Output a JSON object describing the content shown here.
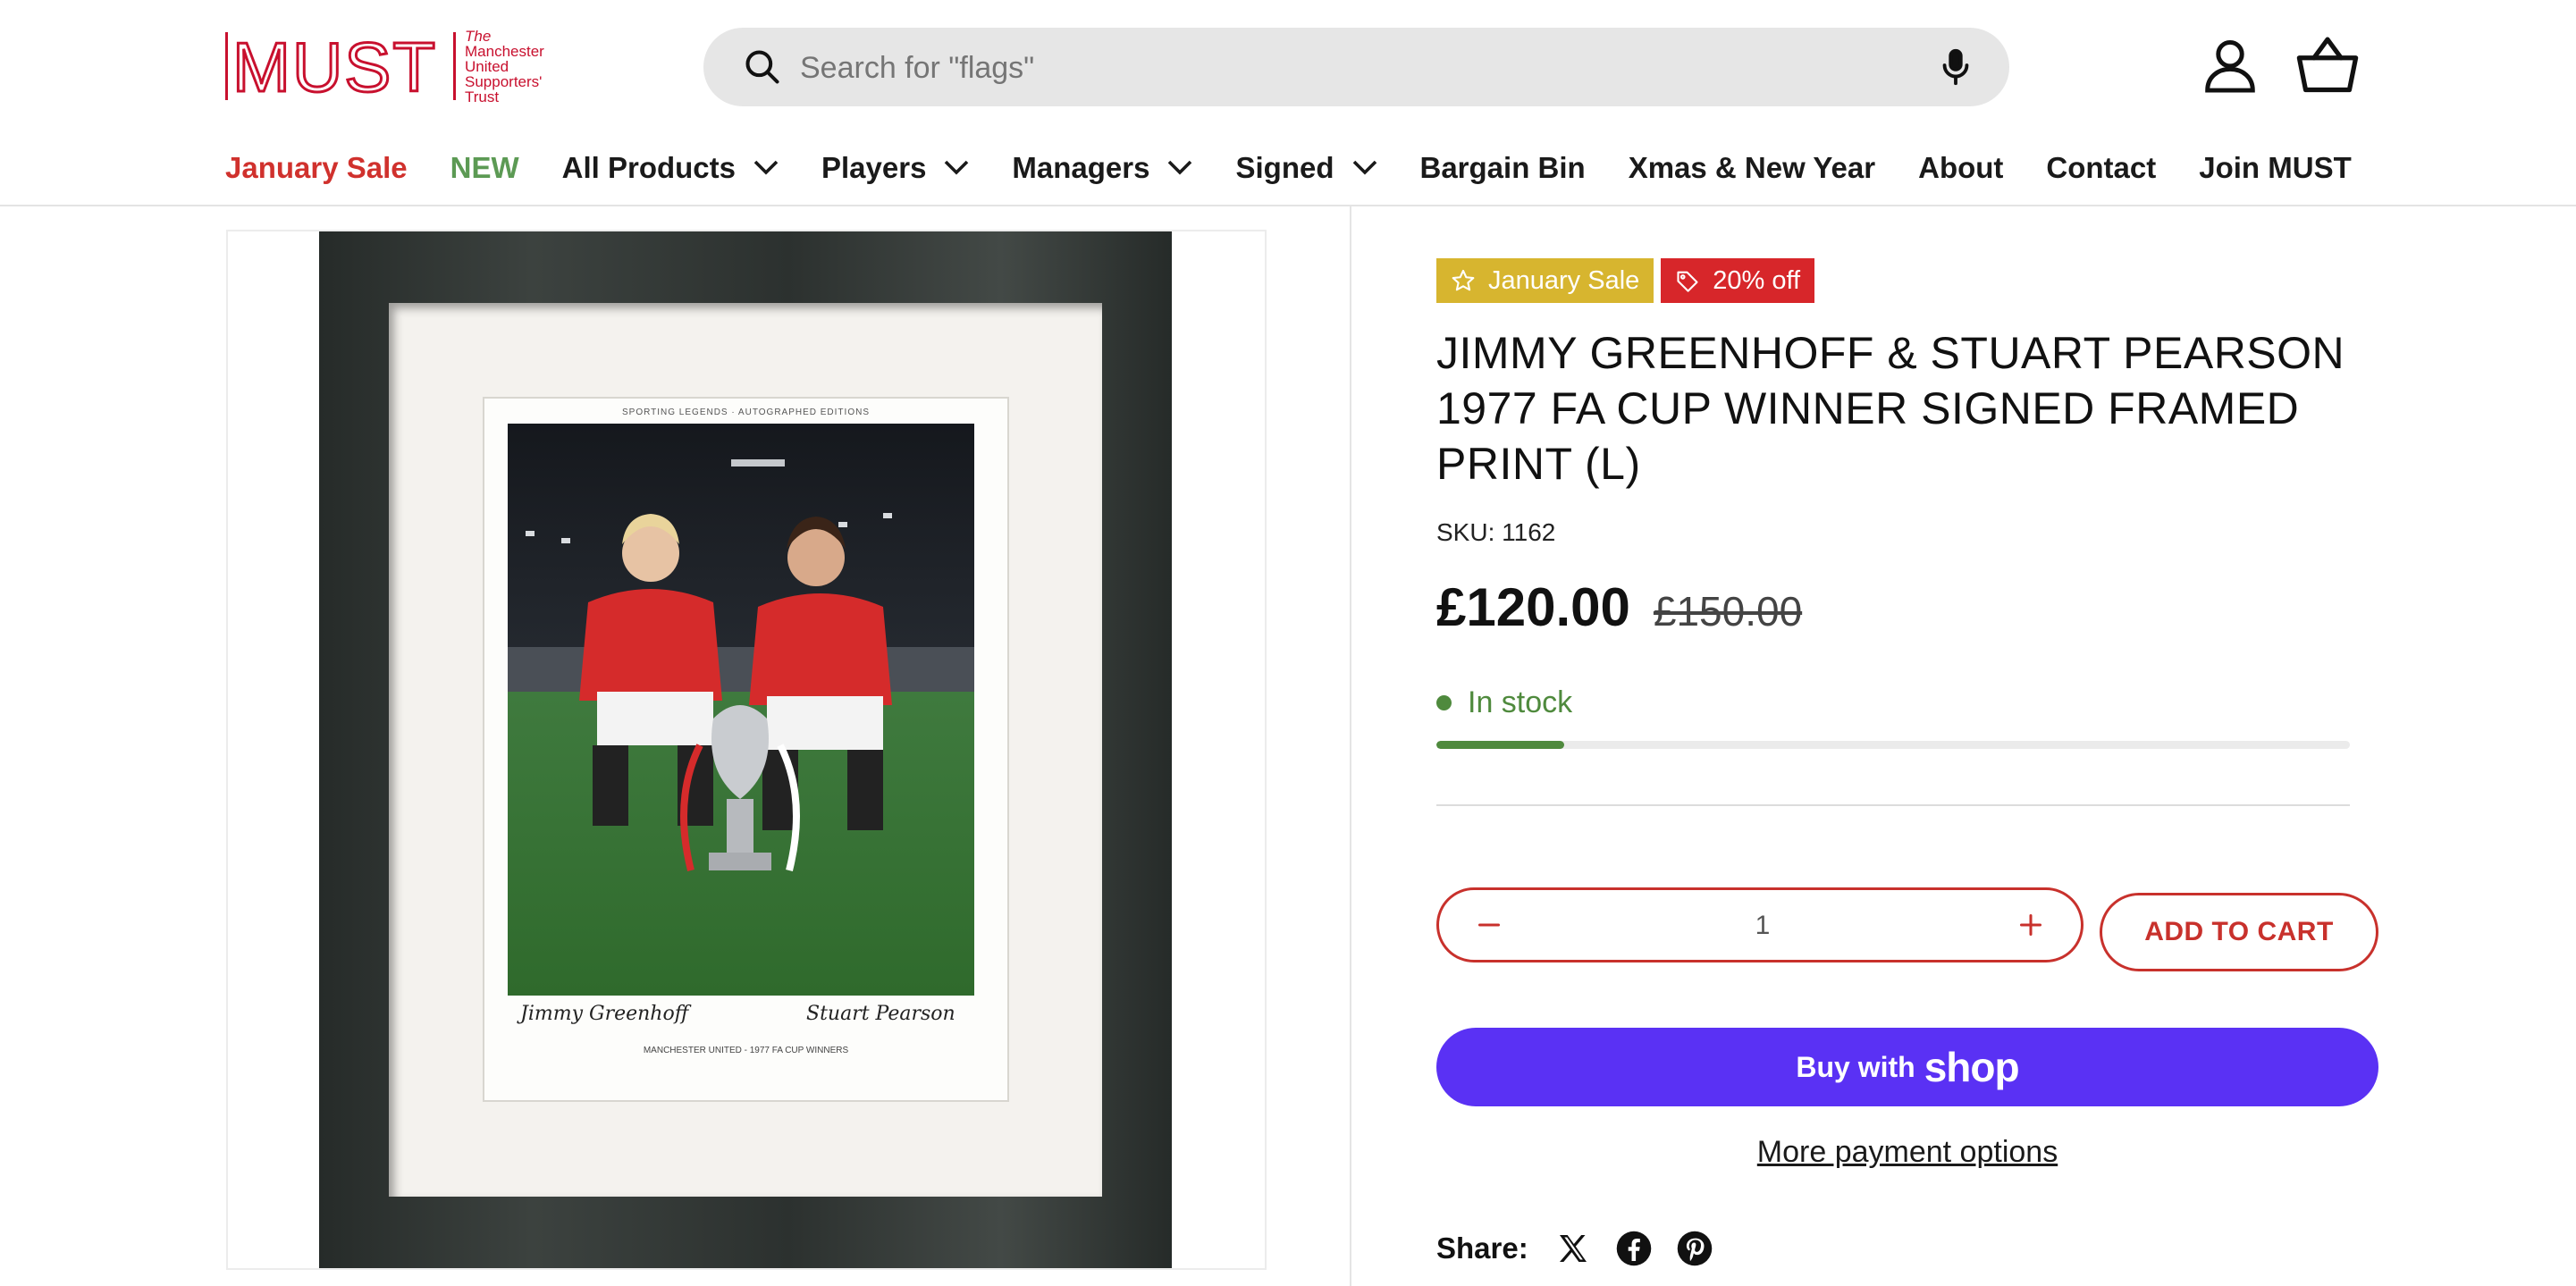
{
  "logo": {
    "wordmark": "MUST",
    "tagline": [
      "The",
      "Manchester",
      "United",
      "Supporters'",
      "Trust"
    ],
    "brand_color": "#c8102e"
  },
  "search": {
    "placeholder": "Search for \"flags\""
  },
  "nav": {
    "items": [
      {
        "label": "January Sale",
        "color": "#d0312d",
        "dropdown": false
      },
      {
        "label": "NEW",
        "color": "#5c9a54",
        "dropdown": false
      },
      {
        "label": "All Products",
        "dropdown": true
      },
      {
        "label": "Players",
        "dropdown": true
      },
      {
        "label": "Managers",
        "dropdown": true
      },
      {
        "label": "Signed",
        "dropdown": true
      },
      {
        "label": "Bargain Bin",
        "dropdown": false
      },
      {
        "label": "Xmas & New Year",
        "dropdown": false
      },
      {
        "label": "About",
        "dropdown": false
      },
      {
        "label": "Contact",
        "dropdown": false
      },
      {
        "label": "Join MUST",
        "dropdown": false
      }
    ]
  },
  "product_image": {
    "print_header": "SPORTING LEGENDS · AUTOGRAPHED EDITIONS",
    "signature_left": "Jimmy Greenhoff",
    "signature_right": "Stuart Pearson",
    "caption": "MANCHESTER UNITED - 1977 FA CUP WINNERS"
  },
  "product": {
    "badges": [
      {
        "label": "January Sale",
        "icon": "star-icon",
        "color": "#d7b52f"
      },
      {
        "label": "20% off",
        "icon": "tag-icon",
        "color": "#d7262a"
      }
    ],
    "title": "JIMMY GREENHOFF & STUART PEARSON 1977 FA CUP WINNER SIGNED FRAMED PRINT (L)",
    "sku": "SKU: 1162",
    "price": "£120.00",
    "compare_price": "£150.00",
    "stock_label": "In stock",
    "stock_level_fraction": 0.14,
    "quantity": "1",
    "add_to_cart": "ADD TO CART",
    "buy_with": "Buy with",
    "shop_brand": "shop",
    "more_payment": "More payment options",
    "share_label": "Share:",
    "share_icons": [
      "x-icon",
      "facebook-icon",
      "pinterest-icon"
    ]
  },
  "colors": {
    "accent": "#c8312c",
    "shop_pay": "#5a31f4",
    "stock_green": "#4f8a3d"
  }
}
